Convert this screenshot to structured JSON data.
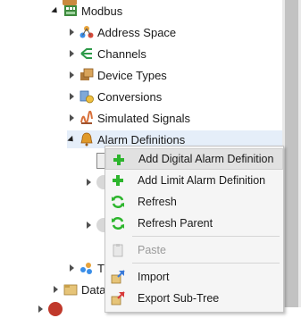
{
  "tree": {
    "modbus": "Modbus",
    "address_space": "Address Space",
    "channels": "Channels",
    "device_types": "Device Types",
    "conversions": "Conversions",
    "simulated_signals": "Simulated Signals",
    "alarm_definitions": "Alarm Definitions",
    "partial_t": "T",
    "partial_data": "Data"
  },
  "context_menu": {
    "items": [
      {
        "label": "Add Digital Alarm Definition",
        "icon": "green-plus-icon"
      },
      {
        "label": "Add Limit Alarm Definition",
        "icon": "green-plus-icon"
      },
      {
        "label": "Refresh",
        "icon": "refresh-icon"
      },
      {
        "label": "Refresh Parent",
        "icon": "refresh-icon"
      },
      {
        "label": "Paste",
        "icon": "paste-icon"
      },
      {
        "label": "Import",
        "icon": "import-icon"
      },
      {
        "label": "Export Sub-Tree",
        "icon": "export-icon"
      }
    ]
  }
}
